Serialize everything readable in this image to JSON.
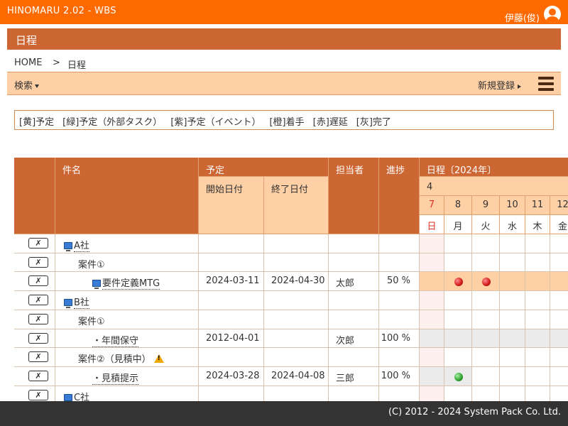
{
  "app": {
    "title": "HINOMARU 2.02 - WBS",
    "user_name": "伊藤(俊)"
  },
  "page": {
    "title": "日程"
  },
  "breadcrumb": {
    "home": "HOME",
    "separator": ">",
    "current": "日程"
  },
  "toolbar": {
    "search_label": "検索",
    "new_label": "新規登録"
  },
  "legend": [
    "[黄]予定",
    "[緑]予定（外部タスク）",
    "[紫]予定（イベント）",
    "[橙]着手",
    "[赤]遅延",
    "[灰]完了"
  ],
  "table": {
    "headers": {
      "name": "件名",
      "plan": "予定",
      "start": "開始日付",
      "end": "終了日付",
      "assignee": "担当者",
      "progress": "進捗",
      "schedule": "日程〔2024年〕",
      "month": "4"
    },
    "days": [
      {
        "d": "7",
        "w": "日"
      },
      {
        "d": "8",
        "w": "月"
      },
      {
        "d": "9",
        "w": "火"
      },
      {
        "d": "10",
        "w": "水"
      },
      {
        "d": "11",
        "w": "木"
      },
      {
        "d": "12",
        "w": "金"
      }
    ],
    "delete_label": "✗",
    "rows": [
      {
        "name": "A社",
        "level": 0,
        "icon": "pc",
        "link": true,
        "start": "",
        "end": "",
        "assignee": "",
        "progress": "",
        "bar": "none"
      },
      {
        "name": "案件①",
        "level": 1,
        "icon": "none",
        "link": false,
        "start": "",
        "end": "",
        "assignee": "",
        "progress": "",
        "bar": "none"
      },
      {
        "name": "要件定義MTG",
        "level": 2,
        "icon": "pc",
        "link": true,
        "start": "2024-03-11",
        "end": "2024-04-30",
        "assignee": "太郎",
        "progress": "50 %",
        "bar": "orange",
        "dots": [
          1,
          2
        ],
        "dot_color": "red"
      },
      {
        "name": "B社",
        "level": 0,
        "icon": "pc",
        "link": true,
        "start": "",
        "end": "",
        "assignee": "",
        "progress": "",
        "bar": "none"
      },
      {
        "name": "案件①",
        "level": 1,
        "icon": "none",
        "link": false,
        "start": "",
        "end": "",
        "assignee": "",
        "progress": "",
        "bar": "none"
      },
      {
        "name": "・年間保守",
        "level": 2,
        "icon": "none",
        "link": true,
        "start": "2012-04-01",
        "end": "",
        "assignee": "次郎",
        "progress": "100 %",
        "bar": "gray-full"
      },
      {
        "name": "案件②（見積中）",
        "level": 1,
        "icon": "warn",
        "link": false,
        "start": "",
        "end": "",
        "assignee": "",
        "progress": "",
        "bar": "none"
      },
      {
        "name": "・見積提示",
        "level": 2,
        "icon": "none",
        "link": true,
        "start": "2024-03-28",
        "end": "2024-04-08",
        "assignee": "三郎",
        "progress": "100 %",
        "bar": "gray-partial",
        "dots": [
          1
        ],
        "dot_color": "green"
      },
      {
        "name": "C社",
        "level": 0,
        "icon": "pc",
        "link": true,
        "start": "",
        "end": "",
        "assignee": "",
        "progress": "",
        "bar": "none"
      }
    ]
  },
  "colors": {
    "accent": "#ff6a00",
    "header": "#cc6633",
    "header_light": "#ffd0a6",
    "sunday_col": "#fff0f0"
  },
  "footer": {
    "copyright": "(C) 2012 - 2024 System Pack Co. Ltd."
  }
}
